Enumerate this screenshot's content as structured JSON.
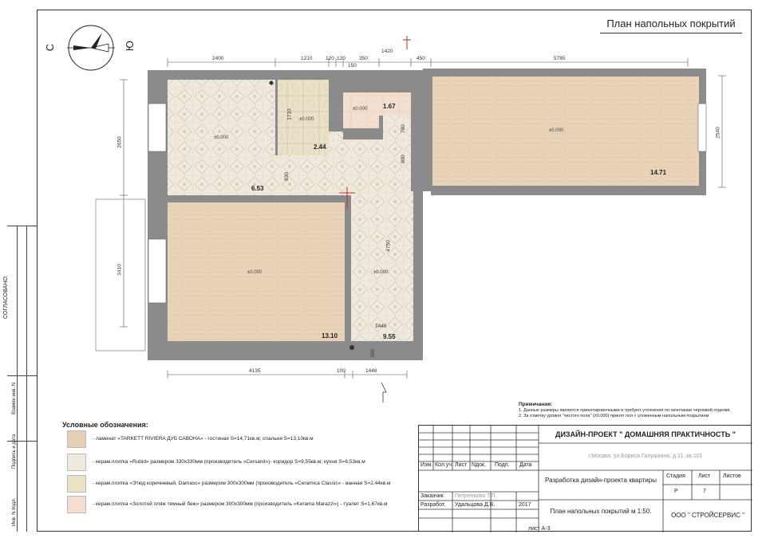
{
  "sheet_title": "План напольных покрытий",
  "compass": {
    "north": "С",
    "south": "Ю"
  },
  "dimensions": {
    "top": [
      "2400",
      "1210",
      "120",
      "120",
      "350",
      "1420",
      "450",
      "5785"
    ],
    "top_small": [
      "150"
    ],
    "bottom": [
      "4135",
      "100",
      "1448"
    ],
    "left": [
      "2650",
      "3410"
    ],
    "right": [
      "2540"
    ],
    "inner": [
      "1710",
      "830",
      "780",
      "800",
      "4750",
      "1448",
      "390"
    ]
  },
  "rooms": [
    {
      "key": "room1",
      "level": "±0.000",
      "area": "6.53"
    },
    {
      "key": "bath",
      "level": "±0.000",
      "area": "2.44"
    },
    {
      "key": "wc",
      "level": "±0.000",
      "area": "1.67"
    },
    {
      "key": "living",
      "level": "±0.000",
      "area": "14.71"
    },
    {
      "key": "bedroom",
      "level": "±0.000",
      "area": "13.10"
    },
    {
      "key": "corridor",
      "level": "±0.000",
      "area": "9.55"
    }
  ],
  "side_stamp": {
    "agreed": "СОГЛАСОВАНО:",
    "cols": [
      "Инв. N подл.",
      "Подпись и дата",
      "Взамен инв. N"
    ]
  },
  "legend": {
    "title": "Условные обозначения:",
    "items": [
      {
        "text": "- ламинат «TARKETT RIVIERA ДУБ САВОНА» - гостиная S=14,71кв.м; спальня S=13,10кв.м",
        "color": "#e6cfb3"
      },
      {
        "text": "- керам.плитка «Rubid» размером 330х330мм (производитель «Cersanit»)- коридор S=9,55кв.м; кухня S=6,53кв.м",
        "color": "#efe9de"
      },
      {
        "text": "- керам.плитка «Этюд коричневый, Damasc» размером 300х300мм (производитель «Ceramica Classic» - ванная S=2,44кв.м",
        "color": "#e9e1c8"
      },
      {
        "text": "- керам.плитка «Золотой пляж темный беж» размером 300х300мм (производитель «Kerama Marazzi») - туалет S=1,67кв.м",
        "color": "#f3dfcf"
      }
    ]
  },
  "notes": {
    "title": "Примечания:",
    "lines": [
      "1. Данные размеры являются ориентировочными и требуют уточнения по окончании черновой отделки.",
      "2. За отметку уровня \"чистого пола\" (±0.000) принят пол с уложенным напольным покрытием"
    ]
  },
  "title_block": {
    "project": "ДИЗАЙН-ПРОЕКТ \" ДОМАШНЯЯ ПРАКТИЧНОСТЬ \"",
    "address": "г.Москва, ул.Бориса Галушкина, д.11, кв.101",
    "headers": [
      "Изм.",
      "Кол.уч",
      "Лист",
      "Nдок.",
      "Подп.",
      "Дата"
    ],
    "customer_label": "Заказчик",
    "customer_name": "Петренкова Т.П.",
    "developer_label": "Разработ.",
    "developer_name": "Удальцова Д.В.",
    "year": "2017",
    "work_title": "Разработка дизайн-проекта квартиры",
    "drawing_title": "План напольных покрытий м 1:50.",
    "stage_label": "Стадия",
    "sheet_label": "Лист",
    "sheets_label": "Листов",
    "stage": "Р",
    "sheet": "7",
    "company": "ООО \" СТРОЙСЕРВИС \""
  },
  "sheet_number": "лист А-3"
}
